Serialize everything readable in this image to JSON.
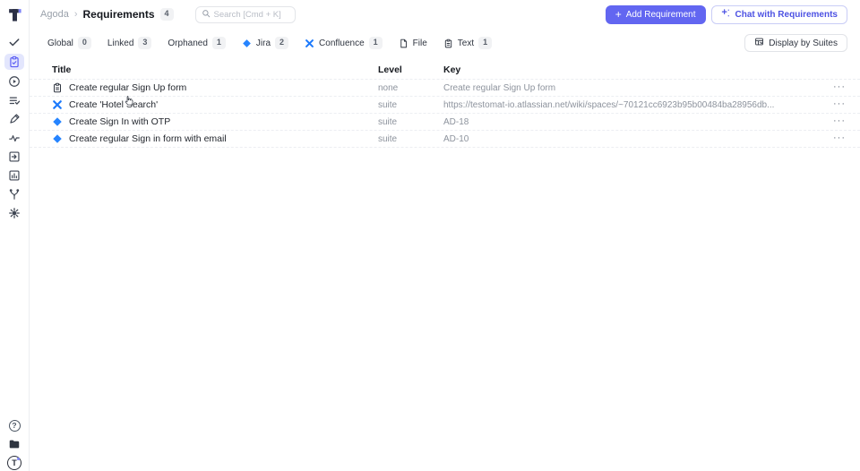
{
  "app": {
    "logo_letter": "T"
  },
  "header": {
    "breadcrumb": {
      "project": "Agoda",
      "separator": "›",
      "page": "Requirements",
      "count": "4"
    },
    "search": {
      "placeholder": "Search [Cmd + K]"
    },
    "add_button": "Add Requirement",
    "chat_button": "Chat with Requirements"
  },
  "filters": {
    "items": [
      {
        "label": "Global",
        "count": "0"
      },
      {
        "label": "Linked",
        "count": "3"
      },
      {
        "label": "Orphaned",
        "count": "1"
      },
      {
        "label": "Jira",
        "count": "2",
        "icon": "jira-icon"
      },
      {
        "label": "Confluence",
        "count": "1",
        "icon": "confluence-icon"
      },
      {
        "label": "File",
        "icon": "file-icon"
      },
      {
        "label": "Text",
        "count": "1",
        "icon": "text-icon"
      }
    ],
    "display_button": "Display by Suites"
  },
  "table": {
    "columns": {
      "title": "Title",
      "level": "Level",
      "key": "Key"
    },
    "row_menu": "···",
    "rows": [
      {
        "icon": "text-icon",
        "title": "Create regular Sign Up form",
        "level": "none",
        "key": "Create regular Sign Up form"
      },
      {
        "icon": "confluence-icon",
        "title": "Create 'Hotel Search'",
        "level": "suite",
        "key": "https://testomat-io.atlassian.net/wiki/spaces/~70121cc6923b95b00484ba28956db..."
      },
      {
        "icon": "jira-icon",
        "title": "Create Sign In with OTP",
        "level": "suite",
        "key": "AD-18"
      },
      {
        "icon": "jira-icon",
        "title": "Create regular Sign in form with email",
        "level": "suite",
        "key": "AD-10"
      }
    ]
  },
  "sidebar": {
    "items": [
      "tests-check-icon",
      "requirements-clipboard-icon",
      "runs-play-icon",
      "plans-list-icon",
      "editor-pencil-icon",
      "automation-pulse-icon",
      "import-icon",
      "reports-icon",
      "branch-icon",
      "settings-gear-icon"
    ],
    "active_item": "requirements-clipboard-icon",
    "bottom_items": [
      "help-icon",
      "projects-folder-icon",
      "account-avatar"
    ]
  },
  "colors": {
    "accent": "#6266f1",
    "accent_light_bg": "#e3e6fd",
    "atlassian_blue": "#2684ff",
    "badge_bg": "#f1f2f4",
    "muted_text": "#8d939d",
    "border": "#eceef2"
  }
}
